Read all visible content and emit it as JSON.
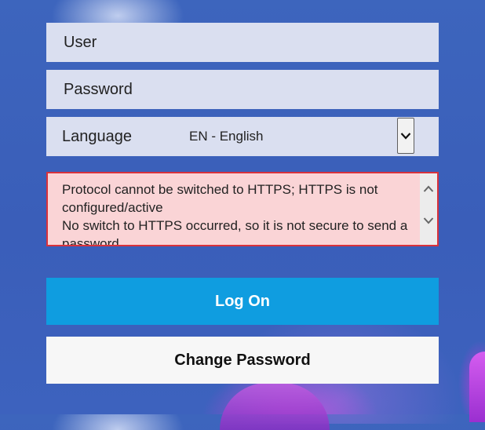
{
  "login": {
    "user_placeholder": "User",
    "password_placeholder": "Password",
    "language_label": "Language",
    "language_value": "EN - English",
    "messages": [
      "Protocol cannot be switched to HTTPS; HTTPS is not configured/active",
      "No switch to HTTPS occurred, so it is not secure to send a password"
    ],
    "logon_label": "Log On",
    "change_password_label": "Change Password"
  },
  "icons": {
    "language_dropdown": "chevron-down-icon",
    "scroll_up": "chevron-up-icon",
    "scroll_down": "chevron-down-icon"
  },
  "colors": {
    "primary_button": "#0f9de0",
    "error_background": "#fad4d6",
    "error_border": "#d8323c",
    "field_background": "#dadff0"
  }
}
